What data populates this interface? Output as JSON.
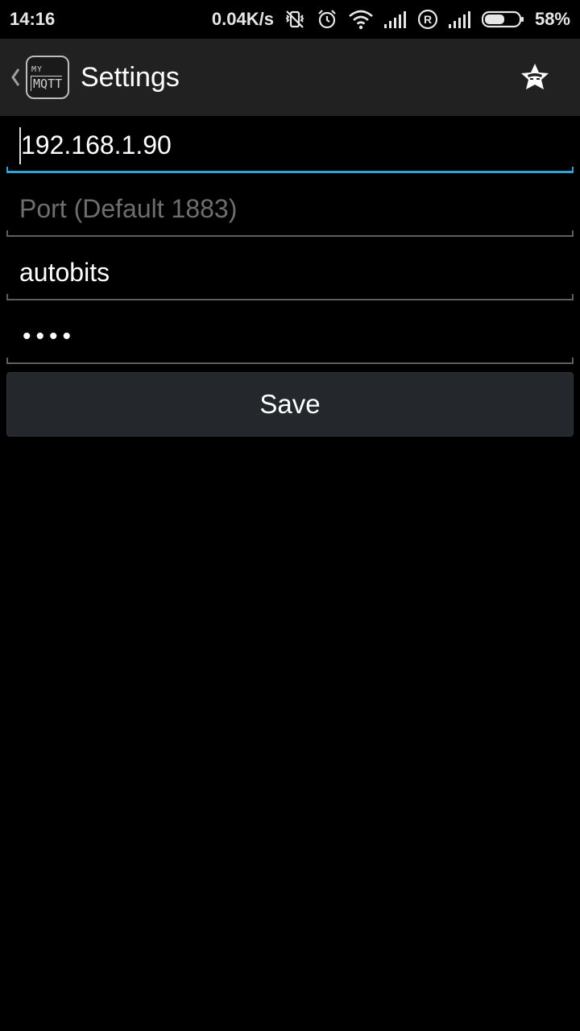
{
  "status_bar": {
    "time": "14:16",
    "net_speed": "0.04K/s",
    "battery": "58%",
    "battery_level": 0.58,
    "icons": [
      "vibrate-off-icon",
      "alarm-icon",
      "wifi-icon",
      "signal-icon",
      "roaming-icon",
      "signal-icon",
      "battery-icon"
    ]
  },
  "action_bar": {
    "logo_top": "MY",
    "logo_bottom": "MQTT",
    "title": "Settings",
    "menu_icon": "star-badge-icon"
  },
  "form": {
    "host": {
      "value": "192.168.1.90"
    },
    "port": {
      "value": "",
      "placeholder": "Port (Default 1883)"
    },
    "username": {
      "value": "autobits"
    },
    "password": {
      "masked": "••••"
    },
    "save_label": "Save"
  },
  "colors": {
    "accent": "#33a0d6",
    "action_bar_bg": "#212121",
    "background": "#000000"
  }
}
